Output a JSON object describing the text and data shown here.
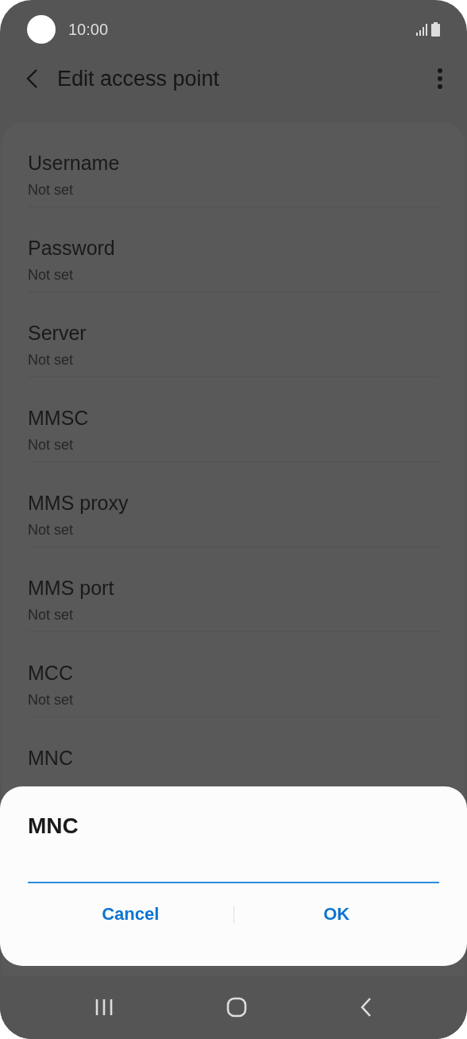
{
  "status_bar": {
    "time": "10:00"
  },
  "toolbar": {
    "title": "Edit access point"
  },
  "settings": [
    {
      "label": "Username",
      "value": "Not set"
    },
    {
      "label": "Password",
      "value": "Not set"
    },
    {
      "label": "Server",
      "value": "Not set"
    },
    {
      "label": "MMSC",
      "value": "Not set"
    },
    {
      "label": "MMS proxy",
      "value": "Not set"
    },
    {
      "label": "MMS port",
      "value": "Not set"
    },
    {
      "label": "MCC",
      "value": "Not set"
    },
    {
      "label": "MNC"
    }
  ],
  "dialog": {
    "title": "MNC",
    "buttons": [
      "Cancel",
      "OK"
    ]
  }
}
